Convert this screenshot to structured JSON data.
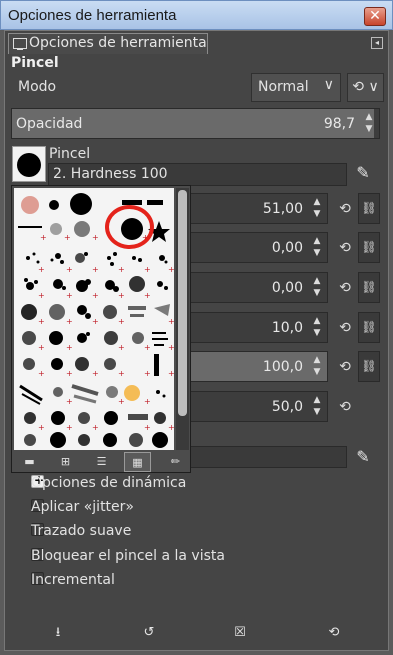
{
  "window": {
    "title": "Opciones de herramienta",
    "close_label": "✕"
  },
  "dock": {
    "tab_label": "Opciones de herramienta",
    "menu_glyph": "◂"
  },
  "section_title": "Pincel",
  "mode": {
    "label": "Modo",
    "value": "Normal",
    "chevron": "∨",
    "extra_glyph": "⟲ ∨"
  },
  "opacity": {
    "label": "Opacidad",
    "value": "98,7",
    "fraction": 0.987
  },
  "brush": {
    "label": "Pincel",
    "name": "2. Hardness 100"
  },
  "icons": {
    "edit": "✎",
    "reset": "⟲",
    "chain": "⛓",
    "spin_arrows": "▲\n▼"
  },
  "rows": [
    {
      "value": "51,00",
      "has_chain": true,
      "fill": 0.0
    },
    {
      "value": "0,00",
      "has_chain": true,
      "fill": 0.0
    },
    {
      "value": "0,00",
      "has_chain": true,
      "fill": 0.0
    },
    {
      "value": "10,0",
      "has_chain": true,
      "fill": 0.0
    },
    {
      "value": "100,0",
      "has_chain": true,
      "fill": 1.0
    },
    {
      "value": "50,0",
      "has_chain": false,
      "fill": 0.0
    }
  ],
  "checkboxes": [
    {
      "label": "Opciones de dinámica",
      "type": "expander"
    },
    {
      "label": "Aplicar «jitter»",
      "type": "checkbox",
      "checked": false
    },
    {
      "label": "Trazado suave",
      "type": "checkbox",
      "checked": false
    },
    {
      "label": "Bloquear el pincel a la vista",
      "type": "checkbox",
      "checked": false
    },
    {
      "label": "Incremental",
      "type": "checkbox",
      "checked": false
    }
  ],
  "bottom_buttons": [
    {
      "name": "save-options-button",
      "glyph": "⭳"
    },
    {
      "name": "restore-options-button",
      "glyph": "↺"
    },
    {
      "name": "delete-options-button",
      "glyph": "☒"
    },
    {
      "name": "reset-options-button",
      "glyph": "⟲"
    }
  ],
  "popup": {
    "buttons": [
      {
        "name": "smaller-previews-button",
        "glyph": "▬"
      },
      {
        "name": "larger-previews-button",
        "glyph": "⊞"
      },
      {
        "name": "view-as-list-button",
        "glyph": "☰"
      },
      {
        "name": "view-as-grid-button",
        "glyph": "▦",
        "active": true
      },
      {
        "name": "open-brush-editor-button",
        "glyph": "✏"
      }
    ]
  },
  "colors": {
    "panel": "#454545",
    "highlight": "#e4231b",
    "titlebar": "#b8cfec"
  }
}
